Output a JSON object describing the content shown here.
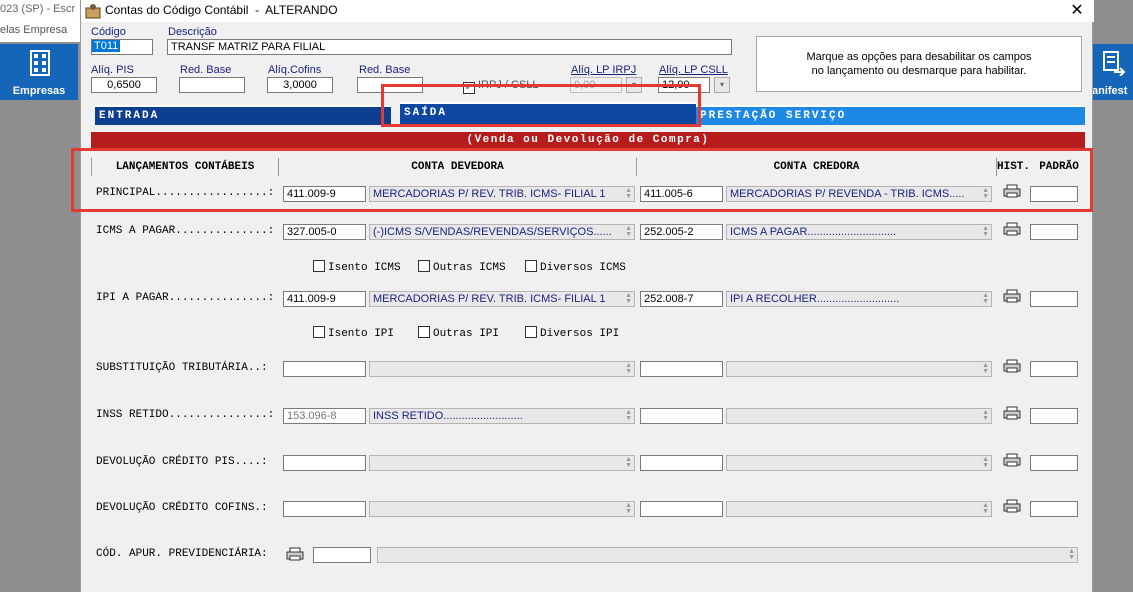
{
  "background_app": {
    "title_text": "023 (SP) - Escr",
    "menu_text": "elas   Empresa",
    "left_tile_label": "Empresas",
    "right_tile_label": "anifest"
  },
  "dialog": {
    "title": "Contas do Código Contábil  -  ALTERANDO",
    "close_glyph": "✕",
    "codigo_label": "Código",
    "codigo_value": "T011",
    "descricao_label": "Descrição",
    "descricao_value": "TRANSF MATRIZ PARA FILIAL",
    "aliq_pis_label": "Alíq. PIS",
    "aliq_pis_value": "0,6500",
    "red_base_label_1": "Red. Base",
    "red_base_value_1": "",
    "aliq_cofins_label": "Alíq.Cofins",
    "aliq_cofins_value": "3,0000",
    "red_base_label_2": "Red. Base",
    "red_base_value_2": "",
    "irpj_csll_label": "IRPJ / CSLL",
    "aliq_lp_irpj_label": "Alíq. LP IRPJ",
    "aliq_lp_irpj_value": "0,00",
    "aliq_lp_csll_label": "Alíq. LP CSLL",
    "aliq_lp_csll_value": "12,00",
    "hint_line1": "Marque as opções para desabilitar os campos",
    "hint_line2": "no lançamento ou desmarque para habilitar."
  },
  "tabs": [
    {
      "label": "ENTRADA"
    },
    {
      "label": "SAÍDA"
    },
    {
      "label": "PRESTAÇÃO SERVIÇO"
    }
  ],
  "banner": "(Venda ou Devolução de Compra)",
  "columns": {
    "lancamentos": "LANÇAMENTOS CONTÁBEIS",
    "devedora": "CONTA DEVEDORA",
    "credora": "CONTA CREDORA",
    "hist": "HIST.",
    "padrao": "PADRÃO"
  },
  "rows": [
    {
      "label": "PRINCIPAL.................:",
      "deb_code": "411.009-9",
      "deb_desc": "MERCADORIAS P/ REV. TRIB. ICMS- FILIAL 1",
      "cred_code": "411.005-6",
      "cred_desc": "MERCADORIAS P/ REVENDA - TRIB. ICMS....."
    },
    {
      "label": "ICMS A PAGAR..............:",
      "deb_code": "327.005-0",
      "deb_desc": "(-)ICMS S/VENDAS/REVENDAS/SERVIÇOS......",
      "cred_code": "252.005-2",
      "cred_desc": "ICMS A PAGAR............................."
    },
    {
      "label": "IPI A PAGAR...............:",
      "deb_code": "411.009-9",
      "deb_desc": "MERCADORIAS P/ REV. TRIB. ICMS- FILIAL 1",
      "cred_code": "252.008-7",
      "cred_desc": "IPI A RECOLHER..........................."
    },
    {
      "label": "SUBSTITUIÇÃO TRIBUTÁRIA..:",
      "deb_code": "",
      "deb_desc": "",
      "cred_code": "",
      "cred_desc": ""
    },
    {
      "label": "INSS RETIDO...............:",
      "deb_code": "153.096-8",
      "deb_desc": "INSS RETIDO..........................",
      "cred_code": "",
      "cred_desc": ""
    },
    {
      "label": "DEVOLUÇÃO CRÉDITO PIS....:",
      "deb_code": "",
      "deb_desc": "",
      "cred_code": "",
      "cred_desc": ""
    },
    {
      "label": "DEVOLUÇÃO CRÉDITO COFINS.:",
      "deb_code": "",
      "deb_desc": "",
      "cred_code": "",
      "cred_desc": ""
    }
  ],
  "icms_checks": [
    "Isento ICMS",
    "Outras ICMS",
    "Diversos ICMS"
  ],
  "ipi_checks": [
    "Isento IPI",
    "Outras IPI",
    "Diversos IPI"
  ],
  "apur_label": "CÓD. APUR. PREVIDENCIÁRIA:",
  "colors": {
    "highlight_red": "#e53935",
    "banner_red": "#b71c1c",
    "tab_blue": "#0d47a1",
    "tab_light_blue": "#1e88e5"
  }
}
